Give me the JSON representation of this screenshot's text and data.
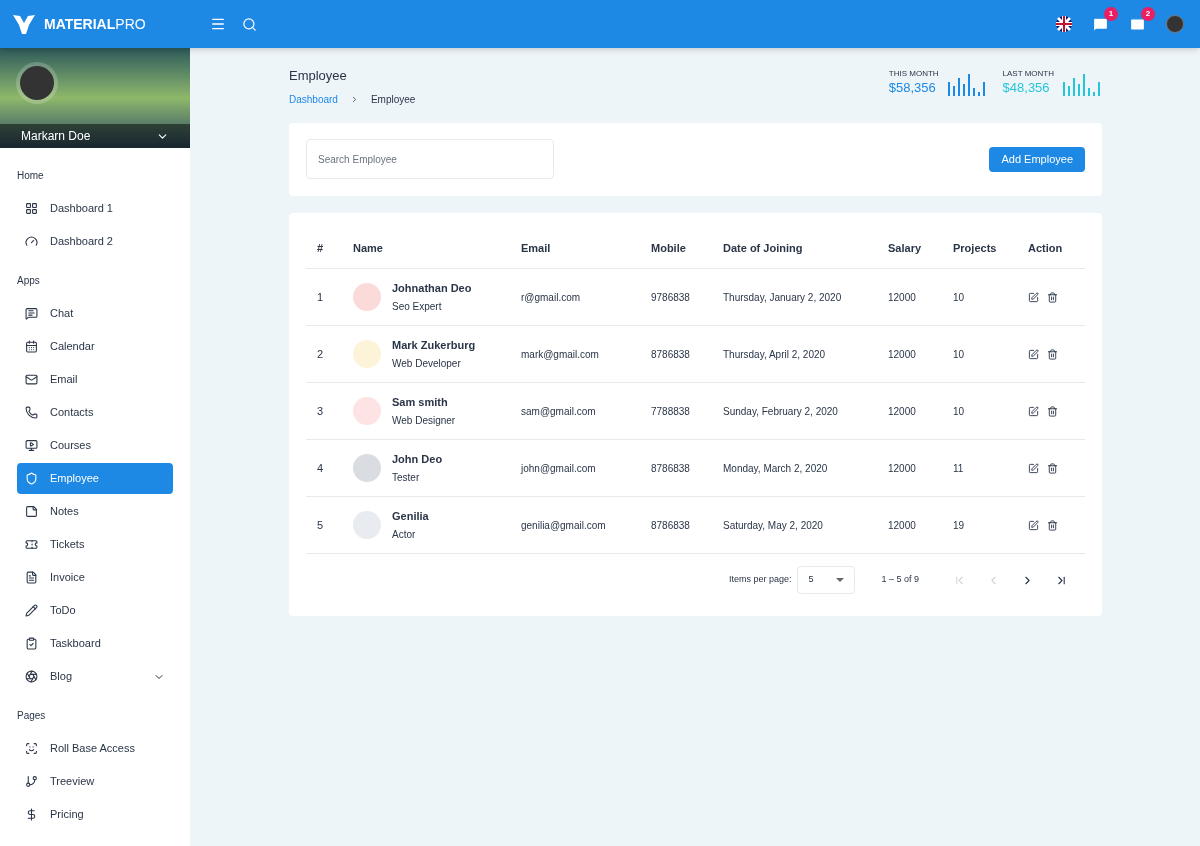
{
  "topbar": {
    "logo": "**MATERIAL**PRO",
    "badges": [
      {
        "count": "1"
      },
      {
        "count": "2"
      }
    ]
  },
  "profile": {
    "name": "Markarn Doe"
  },
  "sidebar": {
    "sections": [
      {
        "title": "Home",
        "items": [
          {
            "label": "Dashboard 1",
            "selected": false
          },
          {
            "label": "Dashboard 2",
            "selected": false
          }
        ]
      },
      {
        "title": "Apps",
        "items": [
          {
            "label": "Chat",
            "selected": false
          },
          {
            "label": "Calendar",
            "selected": false
          },
          {
            "label": "Email",
            "selected": false
          },
          {
            "label": "Contacts",
            "selected": false
          },
          {
            "label": "Courses",
            "selected": false
          },
          {
            "label": "Employee",
            "selected": true
          },
          {
            "label": "Notes",
            "selected": false
          },
          {
            "label": "Tickets",
            "selected": false
          },
          {
            "label": "Invoice",
            "selected": false
          },
          {
            "label": "ToDo",
            "selected": false
          },
          {
            "label": "Taskboard",
            "selected": false
          },
          {
            "label": "Blog",
            "selected": false,
            "expandable": true
          }
        ]
      },
      {
        "title": "Pages",
        "items": [
          {
            "label": "Roll Base Access",
            "selected": false
          },
          {
            "label": "Treeview",
            "selected": false
          },
          {
            "label": "Pricing",
            "selected": false
          }
        ]
      }
    ]
  },
  "page": {
    "title": "Employee",
    "breadcrumb": [
      "Dashboard",
      "Employee"
    ],
    "stats": [
      {
        "label": "THIS MONTH",
        "value": "$58,356",
        "color": "#1e88e5"
      },
      {
        "label": "LAST MONTH",
        "value": "$48,356",
        "color": "#26c6da"
      }
    ]
  },
  "search": {
    "placeholder": "Search Employee"
  },
  "add_button": "Add Employee",
  "table": {
    "columns": [
      "#",
      "Name",
      "Email",
      "Mobile",
      "Date of Joining",
      "Salary",
      "Projects",
      "Action"
    ],
    "rows": [
      {
        "no": "1",
        "name": "Johnathan Deo",
        "role": "Seo Expert",
        "email": "r@gmail.com",
        "mobile": "9786838",
        "date": "Thursday, January 2, 2020",
        "salary": "12000",
        "projects": "10"
      },
      {
        "no": "2",
        "name": "Mark Zukerburg",
        "role": "Web Developer",
        "email": "mark@gmail.com",
        "mobile": "8786838",
        "date": "Thursday, April 2, 2020",
        "salary": "12000",
        "projects": "10"
      },
      {
        "no": "3",
        "name": "Sam smith",
        "role": "Web Designer",
        "email": "sam@gmail.com",
        "mobile": "7788838",
        "date": "Sunday, February 2, 2020",
        "salary": "12000",
        "projects": "10"
      },
      {
        "no": "4",
        "name": "John Deo",
        "role": "Tester",
        "email": "john@gmail.com",
        "mobile": "8786838",
        "date": "Monday, March 2, 2020",
        "salary": "12000",
        "projects": "11"
      },
      {
        "no": "5",
        "name": "Genilia",
        "role": "Actor",
        "email": "genilia@gmail.com",
        "mobile": "8786838",
        "date": "Saturday, May 2, 2020",
        "salary": "12000",
        "projects": "19"
      }
    ]
  },
  "paginator": {
    "label": "Items per page:",
    "page_size": "5",
    "range": "1 – 5 of 9",
    "buttons": [
      {
        "disabled": true
      },
      {
        "disabled": true
      },
      {
        "disabled": false
      },
      {
        "disabled": false
      }
    ]
  }
}
